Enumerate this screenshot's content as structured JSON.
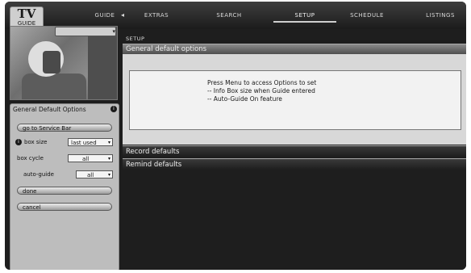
{
  "logo": {
    "line1": "TV",
    "line2": "GUIDE"
  },
  "nav": {
    "back_arrow": "◂",
    "items": [
      {
        "label": "GUIDE",
        "active": false
      },
      {
        "label": "EXTRAS",
        "active": false
      },
      {
        "label": "SEARCH",
        "active": false
      },
      {
        "label": "SETUP",
        "active": true
      },
      {
        "label": "SCHEDULE",
        "active": false
      },
      {
        "label": "LISTINGS",
        "active": false
      }
    ]
  },
  "video": {
    "control_label": "▾"
  },
  "left_panel": {
    "title": "General Default Options",
    "info_symbol": "i",
    "buttons": {
      "service_bar": "go to Service Bar",
      "done": "done",
      "cancel": "cancel"
    },
    "box_size": {
      "label": "box size",
      "value": "last used"
    },
    "box_cycle": {
      "label": "box cycle",
      "value": "all"
    },
    "auto_guide": {
      "label": "auto-guide",
      "value": "all"
    },
    "select_arrow": "▾"
  },
  "content": {
    "breadcrumb": "SETUP",
    "general_header": "General default options",
    "info_lines": [
      "Press Menu to access Options to set",
      "-- Info Box size when Guide entered",
      "-- Auto-Guide On feature"
    ],
    "record_header": "Record defaults",
    "remind_header": "Remind defaults"
  },
  "colors": {
    "background": "#1e1e1e",
    "panel": "#bdbdbd",
    "header_gradient_top": "#8c8c8c",
    "info_box": "#f2f2f2"
  }
}
